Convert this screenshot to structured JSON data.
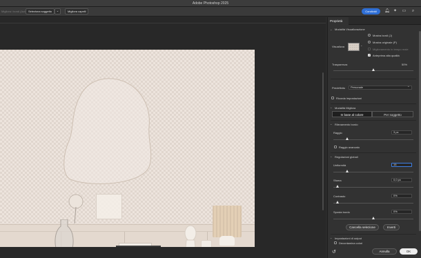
{
  "window": {
    "title": "Adobe Photoshop 2025"
  },
  "options_bar": {
    "dim_label": "Migliora i bordi (Auto)",
    "select_subject_label": "Seleziona soggetto",
    "improve_hair_label": "Migliora capelli",
    "share_label": "Condividi"
  },
  "panel": {
    "tab_label": "Proprietà",
    "view_mode": {
      "heading": "Modalità Visualizzazione",
      "view_label": "Visualizza",
      "show_edges": "Mostra bordi (J)",
      "show_original": "Mostra originale (P)",
      "realtime_refine": "Miglioramento in tempo reale",
      "high_quality_preview": "Anteprima alta qualità"
    },
    "transparency": {
      "label": "Trasparenza",
      "value": "50%",
      "level_percent": 50
    },
    "preset": {
      "label": "Predefinito",
      "value": "Personale"
    },
    "remember_settings": "Ricorda impostazioni",
    "refine_mode": {
      "heading": "Modalità Migliora",
      "option_color": "In base al colore",
      "option_object": "Per soggetto"
    },
    "edge_detection": {
      "heading": "Rilevamento bordo",
      "radius_label": "Raggio",
      "radius_value": "3 px",
      "smart_radius": "Raggio avanzato"
    },
    "global_refinements": {
      "heading": "Regolazioni globali",
      "smooth_label": "Uniformità",
      "smooth_value": "15",
      "feather_label": "Sfuma",
      "feather_value": "0,0 px",
      "contrast_label": "Contrasto",
      "contrast_value": "0%",
      "shift_edge_label": "Sposta bordo",
      "shift_edge_value": "0%",
      "clear_selection": "Cancella selezione",
      "invert": "Inverti"
    },
    "output": {
      "heading": "Impostazioni di output",
      "decontaminate": "Decontamina colori"
    },
    "footer": {
      "cancel": "Annulla",
      "ok": "OK"
    }
  },
  "colors": {
    "accent": "#2f6fd6",
    "panel_bg": "#323232",
    "canvas_bg": "#282828"
  }
}
